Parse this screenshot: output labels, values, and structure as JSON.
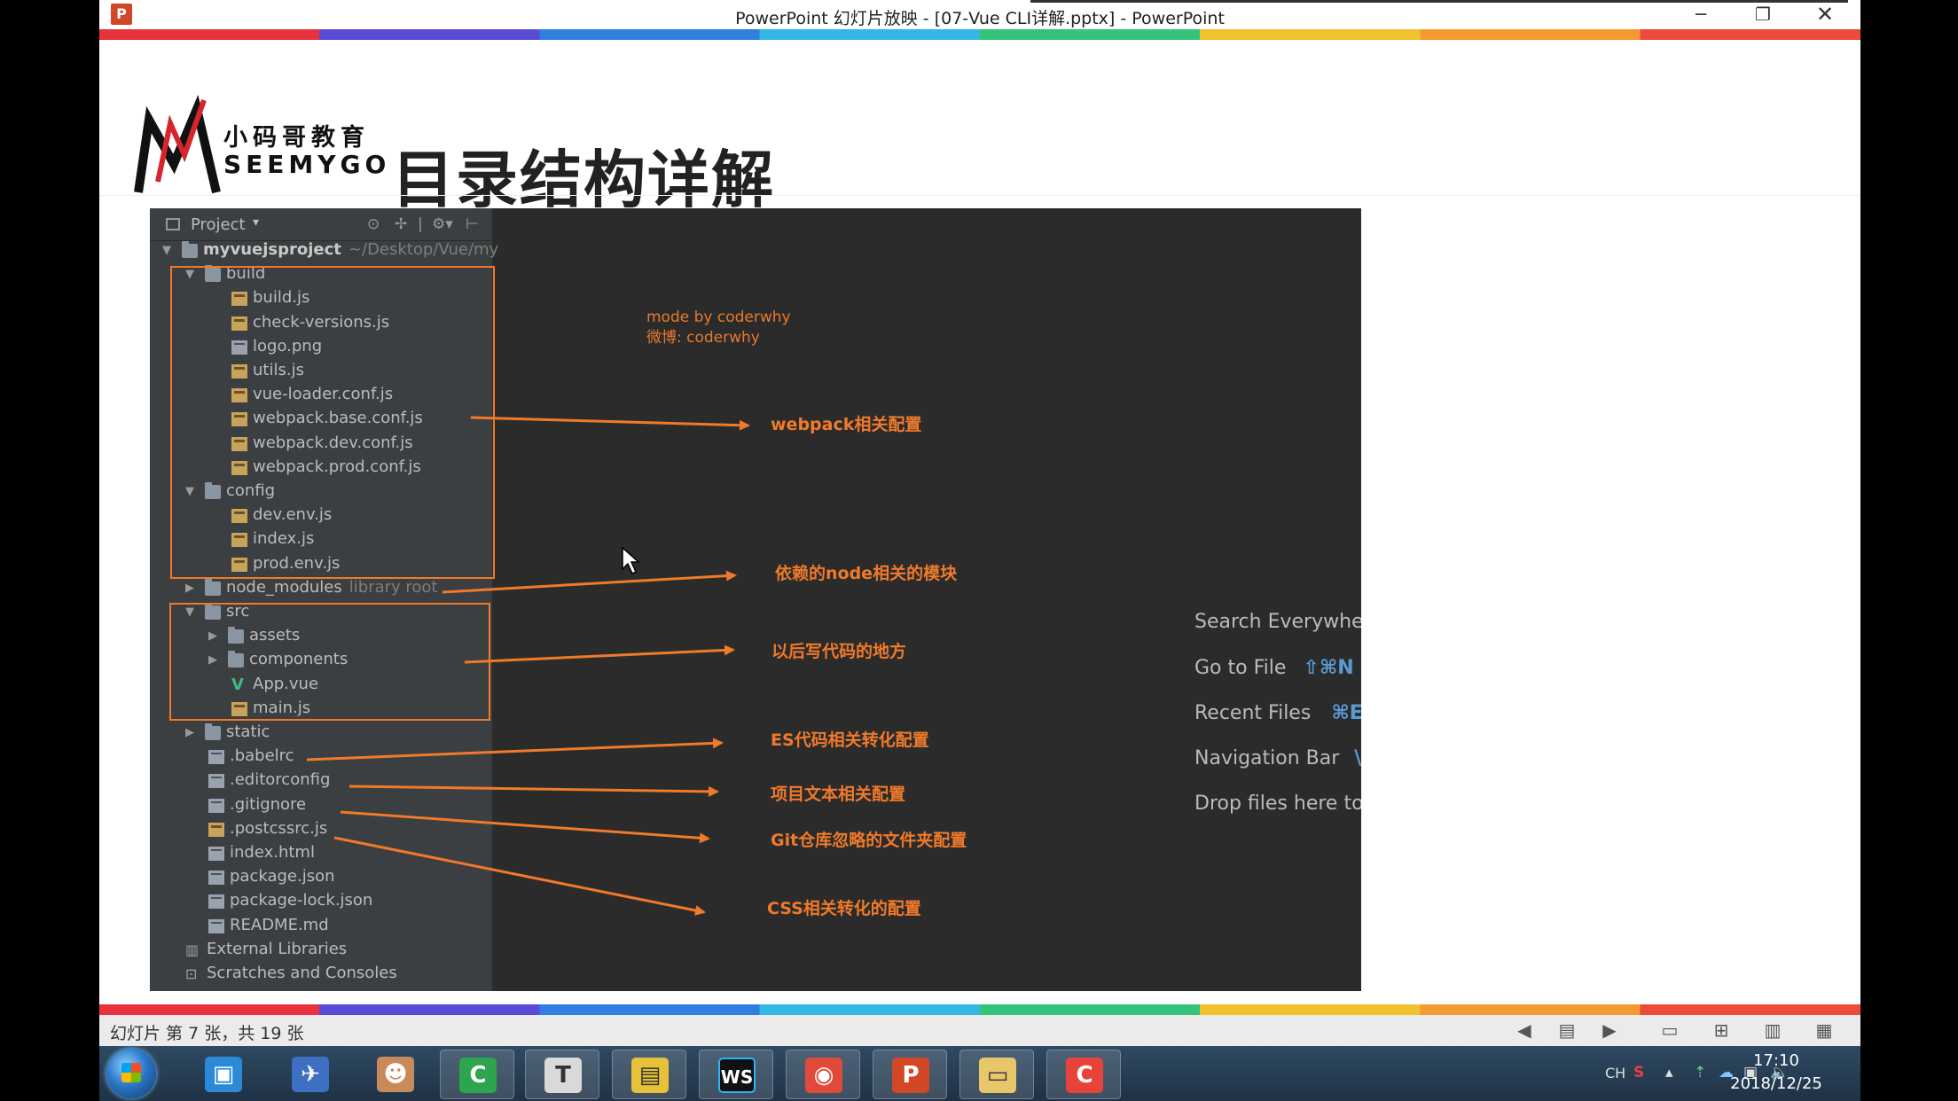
{
  "window": {
    "title": "PowerPoint 幻灯片放映 - [07-Vue CLI详解.pptx] - PowerPoint",
    "app_icon": "P",
    "minimize_glyph": "─",
    "restore_glyph": "❐",
    "close_glyph": "✕"
  },
  "slide": {
    "logo_cn": "小码哥教育",
    "logo_en": "SEEMYGO",
    "title": "目录结构详解"
  },
  "ide": {
    "panel_title": "Project",
    "header_icons": [
      "target-icon",
      "collapse-icon",
      "settings-icon",
      "hide-icon"
    ],
    "credit_line1": "mode by coderwhy",
    "credit_line2": "微博: coderwhy",
    "tree": [
      {
        "name": "myvuejsproject",
        "suffix": "~/Desktop/Vue/my",
        "type": "folder",
        "arrow": "▼",
        "bold": true
      },
      {
        "name": "build",
        "type": "folder",
        "arrow": "▼"
      },
      {
        "name": "build.js",
        "type": "js"
      },
      {
        "name": "check-versions.js",
        "type": "js"
      },
      {
        "name": "logo.png",
        "type": "plain"
      },
      {
        "name": "utils.js",
        "type": "js"
      },
      {
        "name": "vue-loader.conf.js",
        "type": "js"
      },
      {
        "name": "webpack.base.conf.js",
        "type": "js"
      },
      {
        "name": "webpack.dev.conf.js",
        "type": "js"
      },
      {
        "name": "webpack.prod.conf.js",
        "type": "js"
      },
      {
        "name": "config",
        "type": "folder",
        "arrow": "▼"
      },
      {
        "name": "dev.env.js",
        "type": "js"
      },
      {
        "name": "index.js",
        "type": "js"
      },
      {
        "name": "prod.env.js",
        "type": "js"
      },
      {
        "name": "node_modules",
        "suffix": "library root",
        "type": "folder",
        "arrow": "▶"
      },
      {
        "name": "src",
        "type": "folder",
        "arrow": "▼"
      },
      {
        "name": "assets",
        "type": "folder",
        "arrow": "▶"
      },
      {
        "name": "components",
        "type": "folder",
        "arrow": "▶"
      },
      {
        "name": "App.vue",
        "type": "vue"
      },
      {
        "name": "main.js",
        "type": "js"
      },
      {
        "name": "static",
        "type": "folder",
        "arrow": "▶"
      },
      {
        "name": ".babelrc",
        "type": "plain"
      },
      {
        "name": ".editorconfig",
        "type": "plain"
      },
      {
        "name": ".gitignore",
        "type": "plain"
      },
      {
        "name": ".postcssrc.js",
        "type": "js"
      },
      {
        "name": "index.html",
        "type": "plain"
      },
      {
        "name": "package.json",
        "type": "plain"
      },
      {
        "name": "package-lock.json",
        "type": "plain"
      },
      {
        "name": "README.md",
        "type": "plain"
      },
      {
        "name": "External Libraries",
        "type": "lib"
      },
      {
        "name": "Scratches and Consoles",
        "type": "lib"
      }
    ],
    "annotations": [
      "webpack相关配置",
      "依赖的node相关的模块",
      "以后写代码的地方",
      "ES代码相关转化配置",
      "项目文本相关配置",
      "Git仓库忽略的文件夹配置",
      "CSS相关转化的配置"
    ],
    "hints": [
      {
        "label": "Search Everywhe",
        "key": ""
      },
      {
        "label": "Go to File",
        "key": "⇧⌘N"
      },
      {
        "label": "Recent Files",
        "key": "⌘E"
      },
      {
        "label": "Navigation Bar",
        "key": "\\"
      },
      {
        "label": "Drop files here to",
        "key": ""
      }
    ],
    "annotation_color": "#f07a2a"
  },
  "statusbar": {
    "text": "幻灯片 第 7 张，共 19 张"
  },
  "taskbar": {
    "apps": [
      {
        "name": "file-manager-icon",
        "glyph": "▣",
        "color": "#2a8ad8"
      },
      {
        "name": "thunderbird-icon",
        "glyph": "✈",
        "color": "#3d6fc2"
      },
      {
        "name": "avatar-app-icon",
        "glyph": "☻",
        "color": "#c98a5a"
      },
      {
        "name": "camtasia-icon",
        "glyph": "C",
        "color": "#2da44e"
      },
      {
        "name": "typora-icon",
        "glyph": "T",
        "color": "#d9d9d9"
      },
      {
        "name": "notes-icon",
        "glyph": "▤",
        "color": "#e8c13b"
      },
      {
        "name": "webstorm-icon",
        "glyph": "WS",
        "color": "#111111"
      },
      {
        "name": "chrome-icon",
        "glyph": "◉",
        "color": "#e04a3a"
      },
      {
        "name": "powerpoint-icon",
        "glyph": "P",
        "color": "#d24726"
      },
      {
        "name": "explorer-icon",
        "glyph": "▭",
        "color": "#e8c66a"
      },
      {
        "name": "recorder-icon",
        "glyph": "C",
        "color": "#e8433a"
      }
    ],
    "tray_lang": "CH",
    "time": "17:10",
    "date": "2018/12/25"
  }
}
